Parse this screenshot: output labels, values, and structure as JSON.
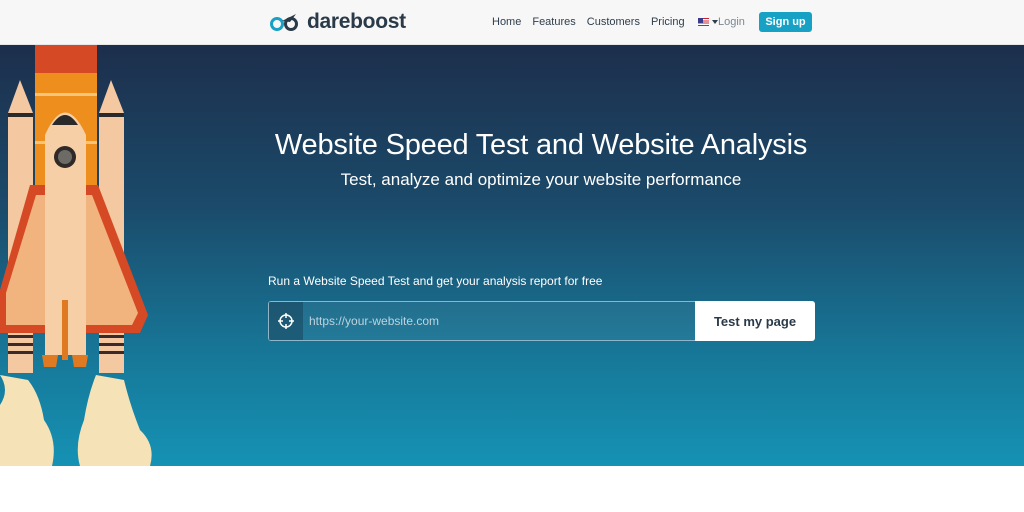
{
  "brand": {
    "name": "dareboost",
    "logo_icon": "binoculars-logo-icon",
    "accent": "#17a1c4",
    "text_color": "#2a3a48"
  },
  "nav": {
    "links": [
      "Home",
      "Features",
      "Customers",
      "Pricing"
    ],
    "language_icon": "us-flag-icon",
    "login": "Login",
    "signup": "Sign up"
  },
  "hero": {
    "title": "Website Speed Test and Website Analysis",
    "subtitle": "Test, analyze and optimize your website performance",
    "illustration_icon": "rocket-icon",
    "gradient": [
      "#1c2f4c",
      "#1592b4"
    ]
  },
  "test_form": {
    "label": "Run a Website Speed Test and get your analysis report for free",
    "url_icon": "crosshair-icon",
    "url_placeholder": "https://your-website.com",
    "url_value": "",
    "submit": "Test my page"
  }
}
